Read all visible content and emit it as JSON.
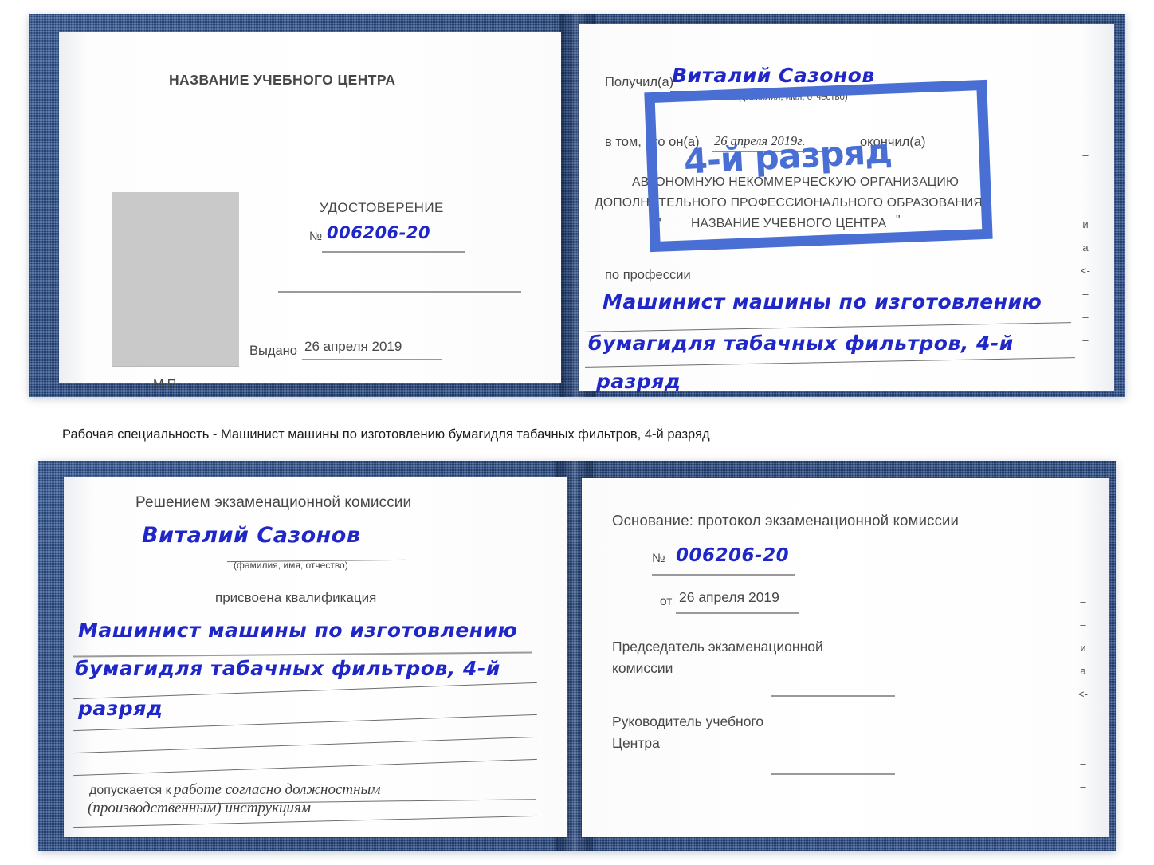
{
  "caption": {
    "text": "Рабочая специальность - Машинист машины по изготовлению бумагидля табачных фильтров, 4-й разряд"
  },
  "colors": {
    "cover_blue": "#2b4f8e",
    "handwriting_blue": "#1f27c8",
    "stamp_blue": "#4a6fd4",
    "print_gray": "#474747",
    "photo_gray": "#c9c9c9"
  },
  "stamp": {
    "label": "4-й разряд"
  },
  "top_certificate": {
    "left_page": {
      "header": "НАЗВАНИЕ УЧЕБНОГО ЦЕНТРА",
      "title": "УДОСТОВЕРЕНИЕ",
      "number_symbol": "№",
      "number_value": "006206-20",
      "issued_label": "Выдано",
      "issued_value": "26 апреля 2019",
      "seal_label": "М.П."
    },
    "right_page": {
      "received_label": "Получил(а)",
      "received_value": "Виталий Сазонов",
      "fio_hint": "(фамилия, имя, отчество)",
      "in_that_label": "в том, что он(а)",
      "in_that_date": "26 апреля 2019г.",
      "finished_label": "окончил(а)",
      "org_line1": "АВТОНОМНУЮ НЕКОММЕРЧЕСКУЮ ОРГАНИЗАЦИЮ",
      "org_line2": "ДОПОЛНИТЕЛЬНОГО ПРОФЕССИОНАЛЬНОГО ОБРАЗОВАНИЯ",
      "org_quote_open": "\"",
      "org_line3": "НАЗВАНИЕ УЧЕБНОГО ЦЕНТРА",
      "org_quote_close": "\"",
      "profession_label": "по профессии",
      "profession_line1": "Машинист машины по изготовлению",
      "profession_line2": "бумагидля табачных фильтров, 4-й",
      "profession_line3": "разряд",
      "edge_marks": [
        "–",
        "–",
        "–",
        "и",
        "а",
        "<-",
        "–",
        "–",
        "–",
        "–"
      ]
    }
  },
  "bottom_certificate": {
    "left_page": {
      "header": "Решением экзаменационной комиссии",
      "name_value": "Виталий Сазонов",
      "fio_hint": "(фамилия, имя, отчество)",
      "qualification_label": "присвоена квалификация",
      "qualification_line1": "Машинист машины по изготовлению",
      "qualification_line2": "бумагидля табачных фильтров, 4-й",
      "qualification_line3": "разряд",
      "admitted_label": "допускается к",
      "admitted_value_line1": "работе согласно должностным",
      "admitted_value_line2": "(производственным) инструкциям"
    },
    "right_page": {
      "basis_label": "Основание: протокол экзаменационной комиссии",
      "number_symbol": "№",
      "number_value": "006206-20",
      "date_label": "от",
      "date_value": "26 апреля 2019",
      "chairman_line1": "Председатель экзаменационной",
      "chairman_line2": "комиссии",
      "head_line1": "Руководитель учебного",
      "head_line2": "Центра",
      "edge_marks": [
        "–",
        "–",
        "и",
        "а",
        "<-",
        "–",
        "–",
        "–",
        "–"
      ]
    }
  }
}
